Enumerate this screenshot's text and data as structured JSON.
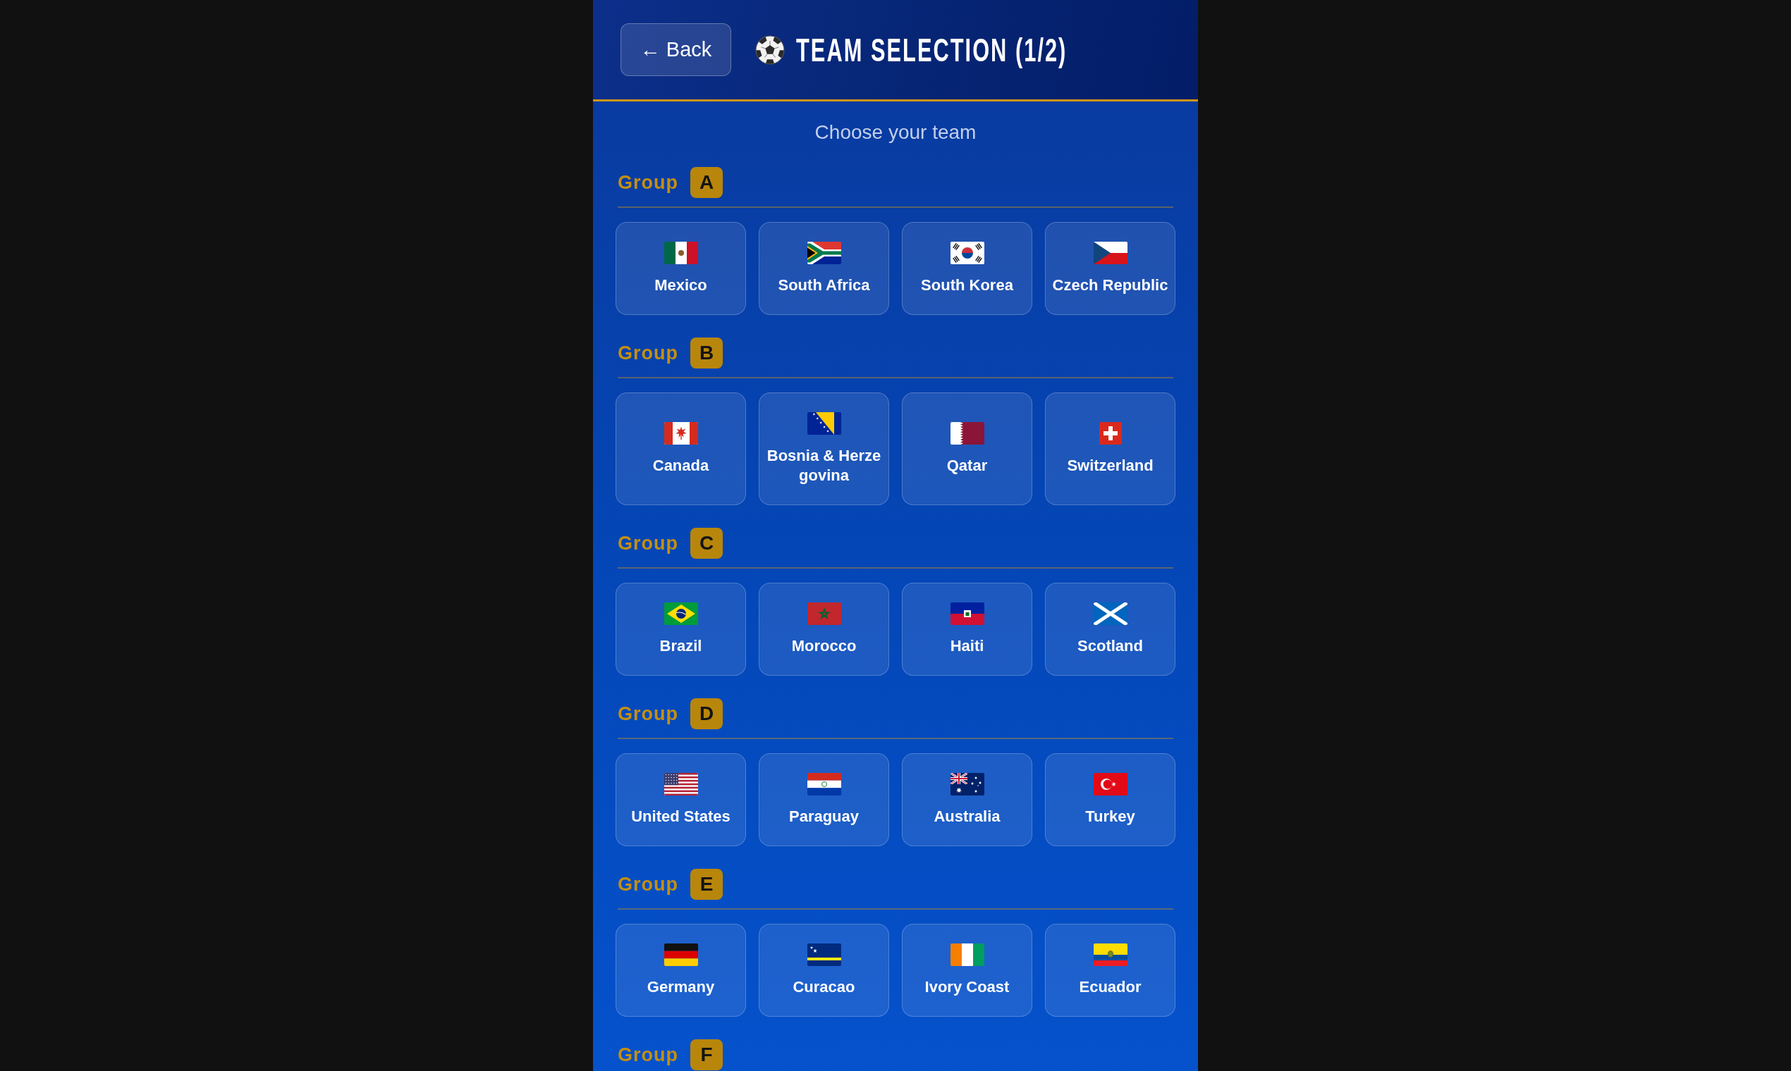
{
  "header": {
    "back_button": "← Back",
    "title": "TEAM SELECTION (1/2)"
  },
  "subtitle": "Choose your team",
  "groups": [
    {
      "label": "Group",
      "letter": "A",
      "teams": [
        "Mexico",
        "South Africa",
        "South Korea",
        "Czech Republic"
      ]
    },
    {
      "label": "Group",
      "letter": "B",
      "teams": [
        "Canada",
        "Bosnia & Herzegovina",
        "Qatar",
        "Switzerland"
      ]
    },
    {
      "label": "Group",
      "letter": "C",
      "teams": [
        "Brazil",
        "Morocco",
        "Haiti",
        "Scotland"
      ]
    },
    {
      "label": "Group",
      "letter": "D",
      "teams": [
        "United States",
        "Paraguay",
        "Australia",
        "Turkey"
      ]
    },
    {
      "label": "Group",
      "letter": "E",
      "teams": [
        "Germany",
        "Curacao",
        "Ivory Coast",
        "Ecuador"
      ]
    },
    {
      "label": "Group",
      "letter": "F"
    }
  ]
}
